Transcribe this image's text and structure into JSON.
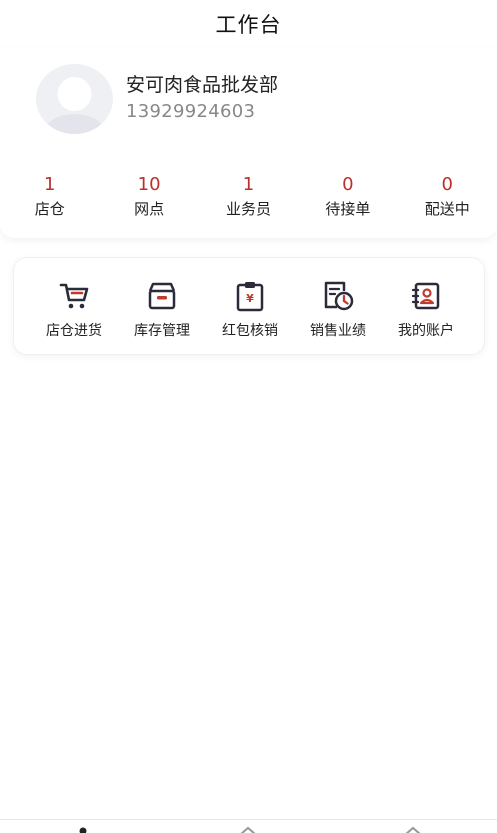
{
  "header": {
    "title": "工作台"
  },
  "profile": {
    "name": "安可肉食品批发部",
    "phone": "13929924603",
    "avatar_icon": "avatar-placeholder-icon"
  },
  "stats": [
    {
      "value": "1",
      "label": "店仓"
    },
    {
      "value": "10",
      "label": "网点"
    },
    {
      "value": "1",
      "label": "业务员"
    },
    {
      "value": "0",
      "label": "待接单"
    },
    {
      "value": "0",
      "label": "配送中"
    }
  ],
  "tools": [
    {
      "label": "店仓进货",
      "icon": "cart-icon"
    },
    {
      "label": "库存管理",
      "icon": "inventory-box-icon"
    },
    {
      "label": "红包核销",
      "icon": "red-packet-clipboard-icon"
    },
    {
      "label": "销售业绩",
      "icon": "sales-report-clock-icon"
    },
    {
      "label": "我的账户",
      "icon": "account-card-icon"
    }
  ],
  "colors": {
    "accent": "#b7322c",
    "icon_dark": "#2b2b3a",
    "icon_red": "#c0392b"
  },
  "bottom_tabs": [
    {
      "icon": "tab-home-icon"
    },
    {
      "icon": "tab-middle-icon"
    },
    {
      "icon": "tab-right-icon"
    }
  ]
}
